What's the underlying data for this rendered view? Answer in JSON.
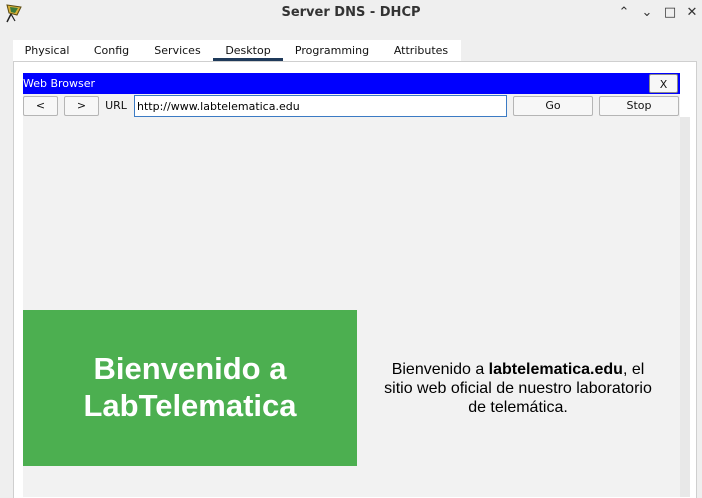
{
  "window": {
    "title": "Server DNS - DHCP",
    "controls": {
      "minimize": "^",
      "restore": "⌃",
      "maximize": "□",
      "close": "✕"
    }
  },
  "tabs": [
    {
      "label": "Physical"
    },
    {
      "label": "Config"
    },
    {
      "label": "Services"
    },
    {
      "label": "Desktop",
      "active": true
    },
    {
      "label": "Programming"
    },
    {
      "label": "Attributes"
    }
  ],
  "browser": {
    "title": "Web Browser",
    "close_label": "X",
    "back_label": "<",
    "forward_label": ">",
    "url_label": "URL",
    "url_value": "http://www.labtelematica.edu",
    "go_label": "Go",
    "stop_label": "Stop"
  },
  "page": {
    "banner_line1": "Bienvenido a",
    "banner_line2": "LabTelematica",
    "welcome_prefix": "Bienvenido a ",
    "welcome_site": "labtelematica.edu",
    "welcome_suffix": ", el sitio web oficial de nuestro laboratorio de telemática."
  },
  "colors": {
    "browser_titlebar": "#0000ff",
    "banner": "#4caf50",
    "active_tab_underline": "#1f3a5a"
  }
}
